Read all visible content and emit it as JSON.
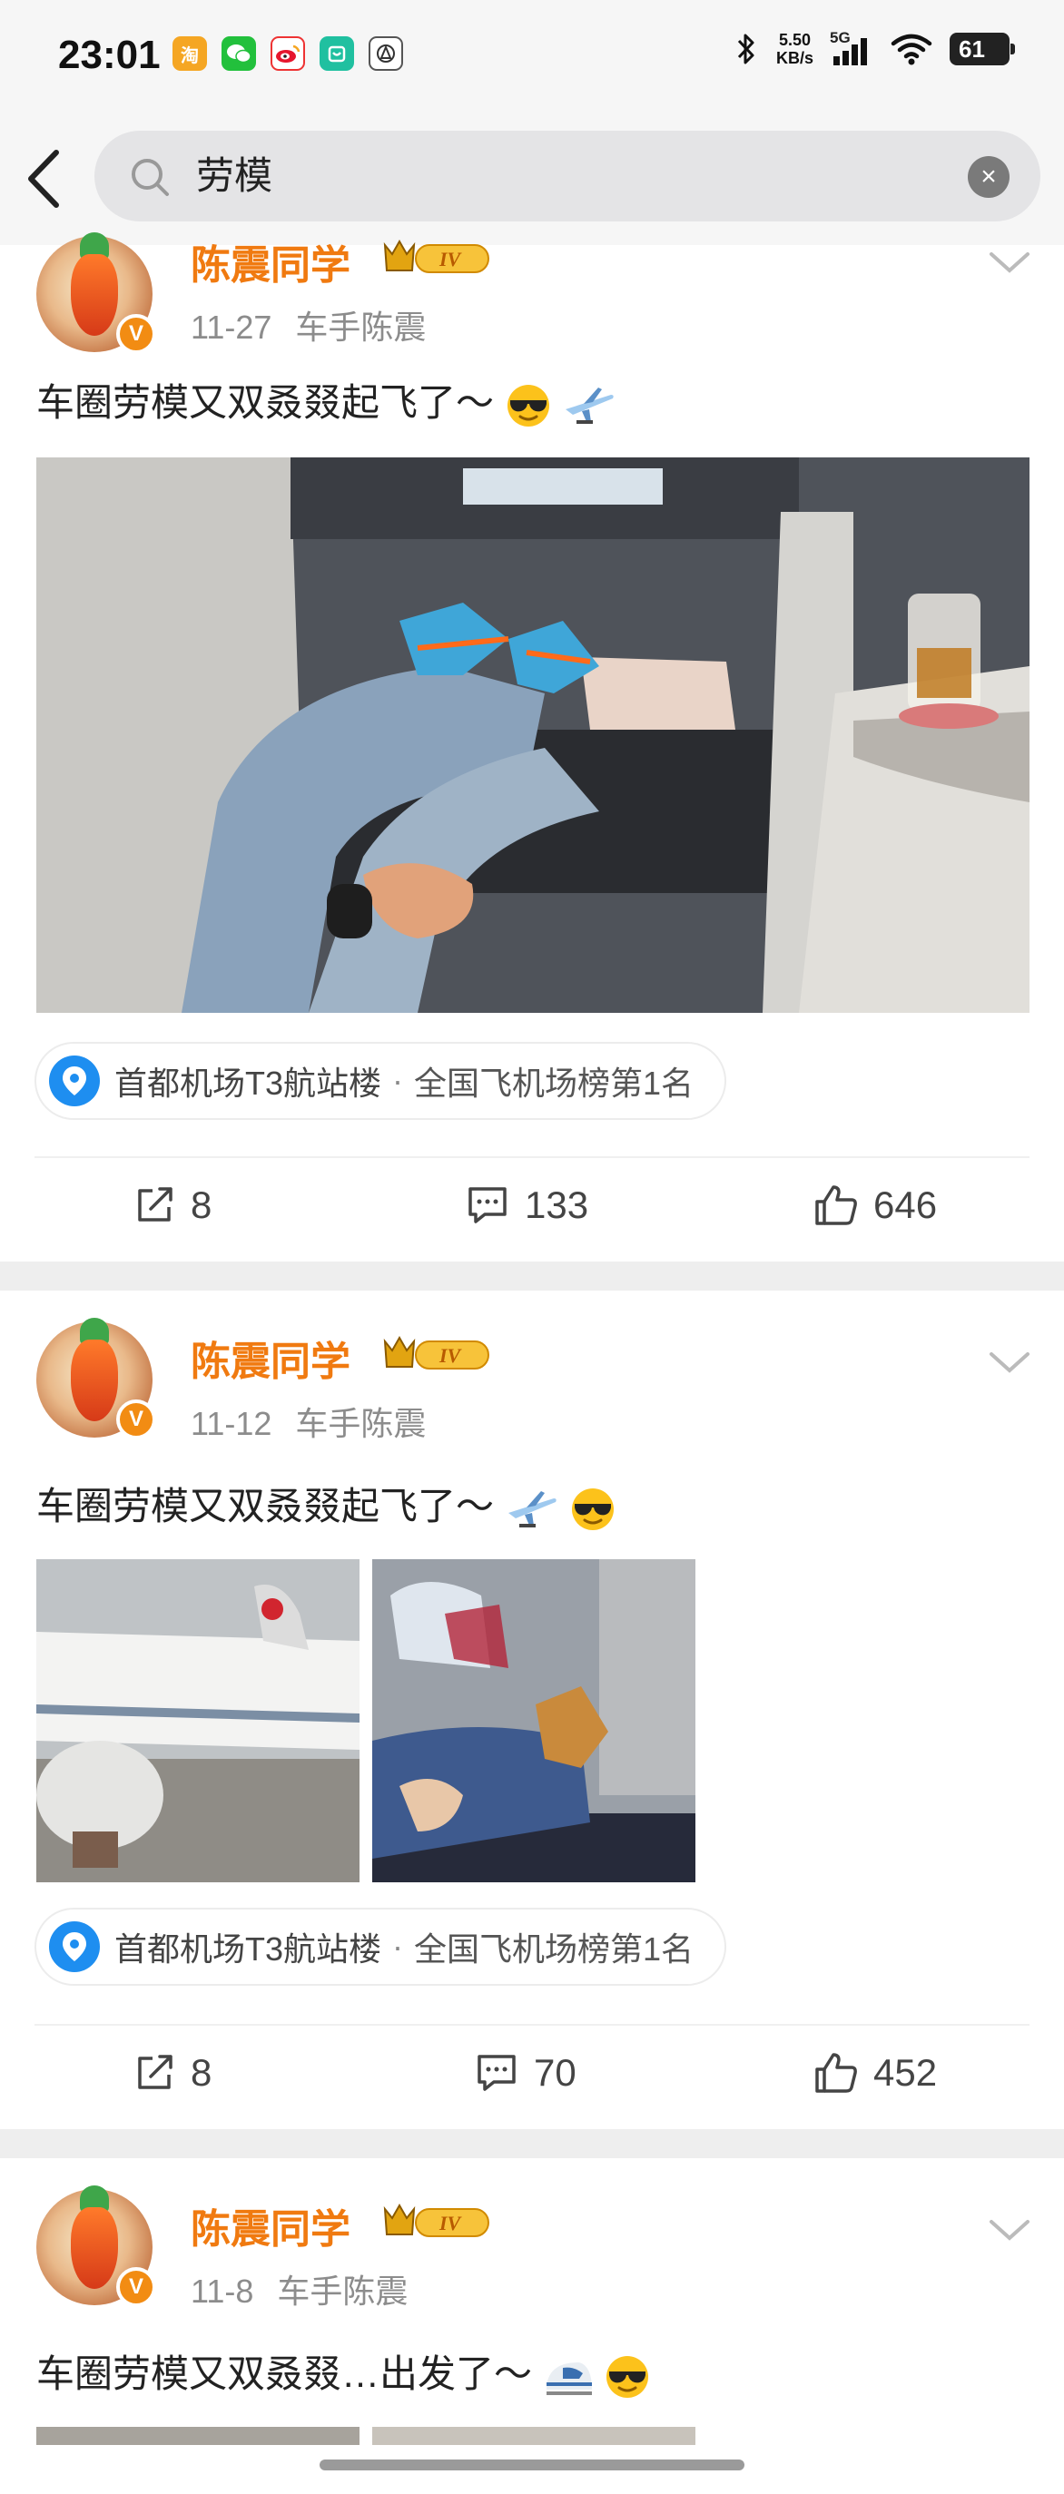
{
  "status_bar": {
    "time": "23:01",
    "net_speed_value": "5.50",
    "net_speed_unit": "KB/s",
    "network": "5G",
    "battery": "61",
    "app_icons": [
      "taobao-icon",
      "wechat-icon",
      "weibo-icon",
      "app-icon",
      "settings-icon"
    ]
  },
  "search": {
    "query": "劳模"
  },
  "posts": [
    {
      "username": "陈震同学",
      "level": "IV",
      "date": "11-27",
      "source": "车手陈震",
      "text": "车圈劳模又双叒叕起飞了～",
      "location": "首都机场T3航站楼",
      "location_rank": "全国飞机场榜第1名",
      "reposts": "8",
      "comments": "133",
      "likes": "646"
    },
    {
      "username": "陈震同学",
      "level": "IV",
      "date": "11-12",
      "source": "车手陈震",
      "text": "车圈劳模又双叒叕起飞了～",
      "location": "首都机场T3航站楼",
      "location_rank": "全国飞机场榜第1名",
      "reposts": "8",
      "comments": "70",
      "likes": "452"
    },
    {
      "username": "陈震同学",
      "level": "IV",
      "date": "11-8",
      "source": "车手陈震",
      "text": "车圈劳模又双叒叕…出发了～"
    }
  ],
  "colors": {
    "username": "#f07a10",
    "location_icon": "#1e8ef0",
    "verified_badge": "#f28c13"
  }
}
